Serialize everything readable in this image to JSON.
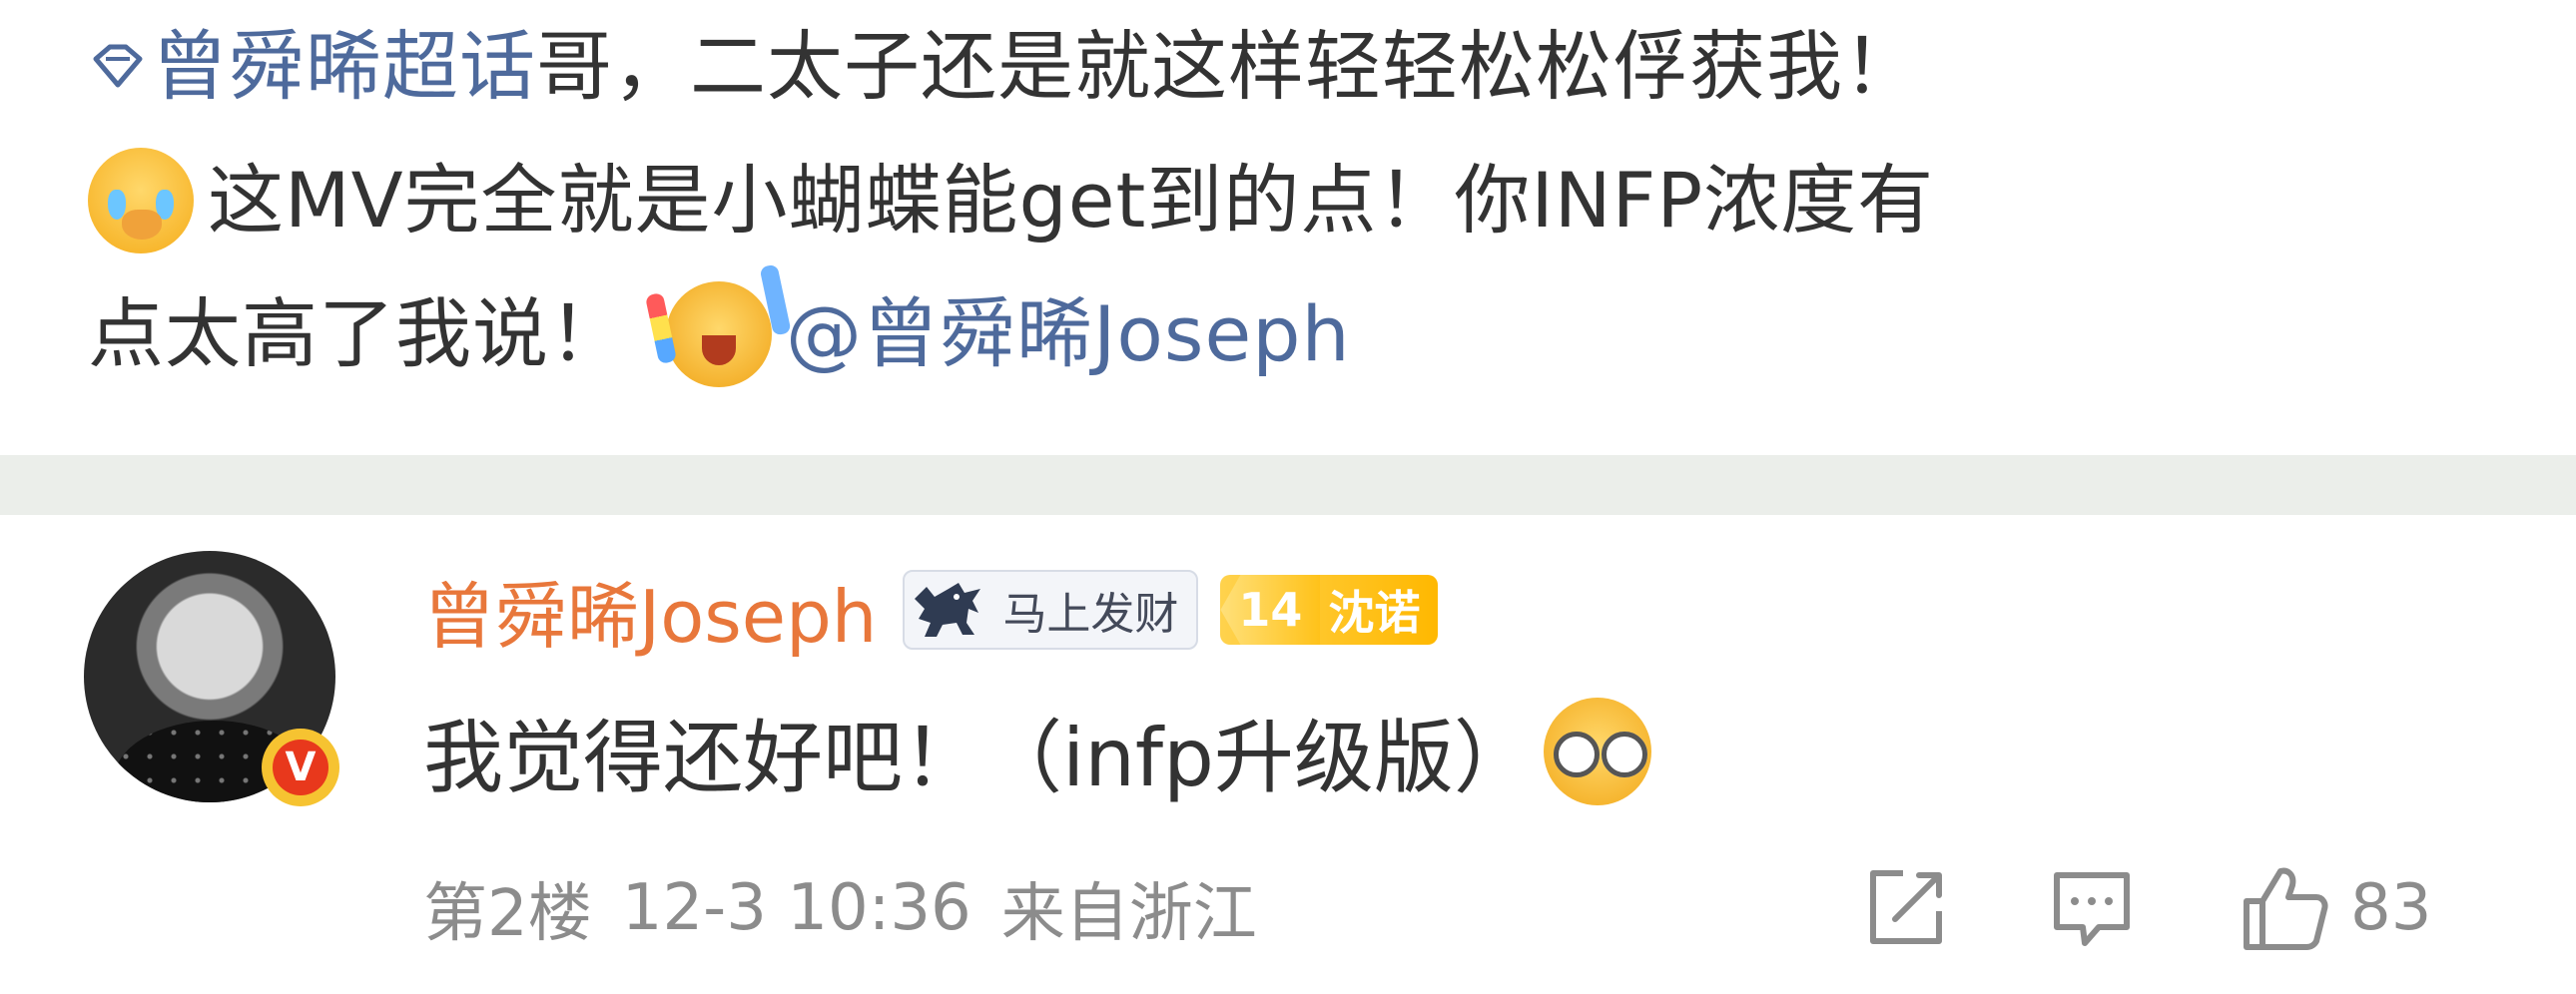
{
  "post": {
    "topic_link": "曾舜晞超话",
    "text_part1": " 哥，二太子还是就这样轻轻松松俘获我！",
    "text_part2": " 这MV完全就是小蝴蝶能get到的点！你INFP浓度有",
    "text_part3": "点太高了我说！",
    "mention": "@曾舜晞Joseph",
    "icons": [
      "diamond-icon",
      "crying-emoji",
      "cheer-emoji"
    ]
  },
  "comment": {
    "username": "曾舜晞Joseph",
    "fortune_badge": "马上发财",
    "fan_badge_level": "14",
    "fan_badge_name": "沈诺",
    "text": "我觉得还好吧！（infp升级版）",
    "emoji": "glasses-emoji",
    "verified_mark": "V",
    "floor": "第2楼",
    "time": "12-3 10:36",
    "location": "来自浙江",
    "like_count": "83",
    "colors": {
      "username": "#e8773b",
      "link": "#4e6a9c",
      "meta": "#8c8c8c",
      "divider": "#ebeeea"
    }
  }
}
